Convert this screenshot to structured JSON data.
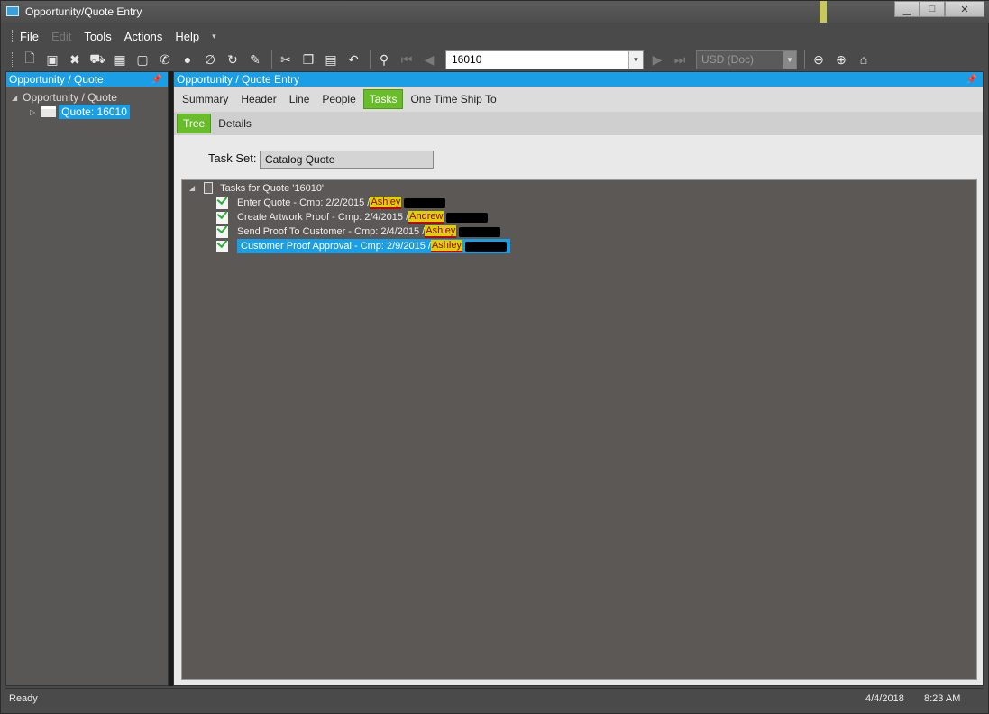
{
  "window": {
    "title": "Opportunity/Quote Entry",
    "minimize": "▁",
    "maximize": "□",
    "close": "✕"
  },
  "menu": {
    "items": [
      {
        "label": "File",
        "enabled": true
      },
      {
        "label": "Edit",
        "enabled": false
      },
      {
        "label": "Tools",
        "enabled": true
      },
      {
        "label": "Actions",
        "enabled": true
      },
      {
        "label": "Help",
        "enabled": true
      }
    ]
  },
  "toolbar": {
    "record_value": "16010",
    "currency_value": "USD (Doc)",
    "icons": [
      "new-icon",
      "save-icon",
      "delete-icon",
      "attach-icon",
      "grid-icon",
      "note-icon",
      "phone-icon",
      "comment-icon",
      "link-icon",
      "refresh-icon",
      "clear-icon",
      "cut-icon",
      "copy-icon",
      "paste-icon",
      "undo-icon",
      "search-icon",
      "first-icon",
      "prev-icon",
      "next-icon",
      "last-icon",
      "back-icon",
      "forward-icon",
      "home-icon"
    ]
  },
  "left_panel": {
    "header": "Opportunity / Quote",
    "tree_root": "Opportunity / Quote",
    "tree_child": "Quote: 16010"
  },
  "main_panel": {
    "header": "Opportunity / Quote Entry",
    "tabs": [
      "Summary",
      "Header",
      "Line",
      "People",
      "Tasks",
      "One Time Ship To"
    ],
    "active_tab": "Tasks",
    "subtabs": [
      "Tree",
      "Details"
    ],
    "active_subtab": "Tree",
    "task_set_label": "Task Set:",
    "task_set_value": "Catalog Quote",
    "tree_root": "Tasks for Quote '16010'",
    "tasks": [
      {
        "text": "Enter Quote - Cmp: 2/2/2015 / ",
        "person": "Ashley",
        "completed": true
      },
      {
        "text": "Create Artwork Proof - Cmp: 2/4/2015 / ",
        "person": "Andrew",
        "completed": true
      },
      {
        "text": "Send Proof To Customer - Cmp: 2/4/2015 / ",
        "person": "Ashley",
        "completed": true
      },
      {
        "text": "Customer Proof Approval - Cmp: 2/9/2015 / ",
        "person": "Ashley",
        "completed": true,
        "selected": true
      }
    ]
  },
  "status": {
    "text": "Ready",
    "date": "4/4/2018",
    "time": "8:23 AM"
  },
  "colors": {
    "accent": "#1a9fe6",
    "active_tab": "#6abd2a",
    "background": "#5b5856"
  }
}
